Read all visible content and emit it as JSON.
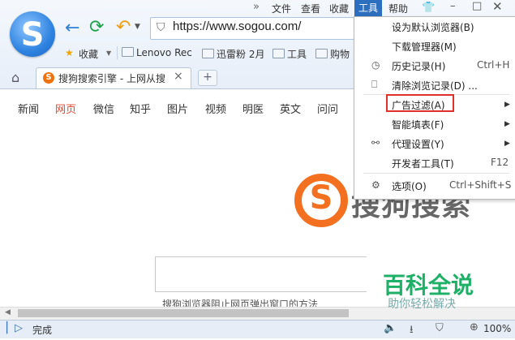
{
  "toolbar": {
    "url": "https://www.sogou.com/"
  },
  "menubar": {
    "chevron": "»",
    "file": "文件",
    "view": "查看",
    "favorites": "收藏",
    "tools": "工具",
    "help": "帮助"
  },
  "bookmarks": {
    "favorites_label": "收藏",
    "items": [
      "Lenovo Rec",
      "迅雷粉 2月",
      "工具",
      "购物"
    ]
  },
  "tab": {
    "title": "搜狗搜索引擎 - 上网从搜",
    "favicon": "S"
  },
  "page": {
    "nav": [
      "新闻",
      "网页",
      "微信",
      "知乎",
      "图片",
      "视频",
      "明医",
      "英文",
      "问问"
    ],
    "active_nav": "网页",
    "brand": "搜狗搜索",
    "logo_letter": "S",
    "hint": "搜狗浏览器阻止网页弹出窗口的方法"
  },
  "status": {
    "text": "完成",
    "zoom": "100%"
  },
  "tools_menu": {
    "items": [
      {
        "label": "设为默认浏览器(B)",
        "shortcut": "",
        "icon": "",
        "submenu": false
      },
      {
        "label": "下载管理器(M)",
        "shortcut": "",
        "icon": "",
        "submenu": false
      },
      {
        "label": "历史记录(H)",
        "shortcut": "Ctrl+H",
        "icon": "clock-icon",
        "submenu": false
      },
      {
        "label": "清除浏览记录(D) ...",
        "shortcut": "",
        "icon": "eraser-icon",
        "submenu": false
      },
      {
        "label": "广告过滤(A)",
        "shortcut": "",
        "icon": "",
        "submenu": true,
        "highlighted": true
      },
      {
        "label": "智能填表(F)",
        "shortcut": "",
        "icon": "",
        "submenu": true
      },
      {
        "label": "代理设置(Y)",
        "shortcut": "",
        "icon": "link-icon",
        "submenu": true
      },
      {
        "label": "开发者工具(T)",
        "shortcut": "F12",
        "icon": "",
        "submenu": false
      },
      {
        "label": "选项(O)",
        "shortcut": "Ctrl+Shift+S",
        "icon": "gear-icon",
        "submenu": false
      }
    ]
  },
  "watermark": {
    "title": "百科全说",
    "subtitle": "助你轻松解决"
  },
  "colors": {
    "accent": "#2c6fbe",
    "brand_orange": "#f37021",
    "highlight_box": "#e0302b"
  }
}
